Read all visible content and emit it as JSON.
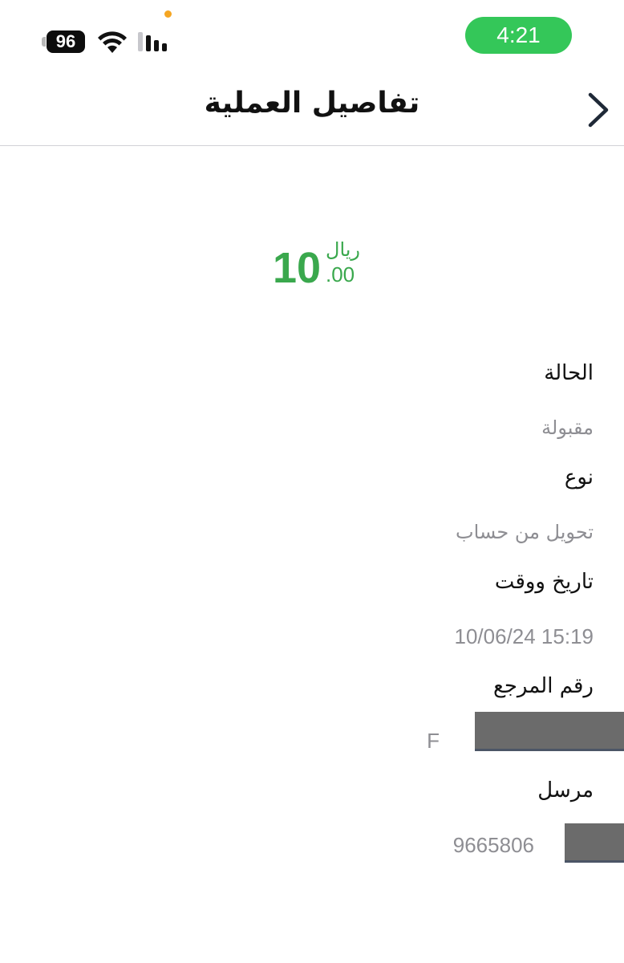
{
  "status_bar": {
    "battery_level": "96",
    "time": "4:21",
    "icons": [
      "wifi-icon",
      "cellular-signal-icon",
      "privacy-indicator-dot"
    ],
    "colors": {
      "time_pill": "#34c759",
      "privacy_dot": "#f5a623"
    }
  },
  "header": {
    "title": "تفاصيل العملية",
    "back_icon": "chevron-right-icon"
  },
  "amount": {
    "integer": "10",
    "currency": "ريال",
    "decimal": ".00",
    "color": "#3aa84d"
  },
  "details": [
    {
      "label": "الحالة",
      "value": "مقبولة"
    },
    {
      "label": "نوع",
      "value": "تحويل من حساب"
    },
    {
      "label": "تاريخ ووقت",
      "value": "10/06/24 15:19"
    },
    {
      "label": "رقم المرجع",
      "value": "F"
    },
    {
      "label": "مرسل",
      "value": "9665806"
    }
  ]
}
